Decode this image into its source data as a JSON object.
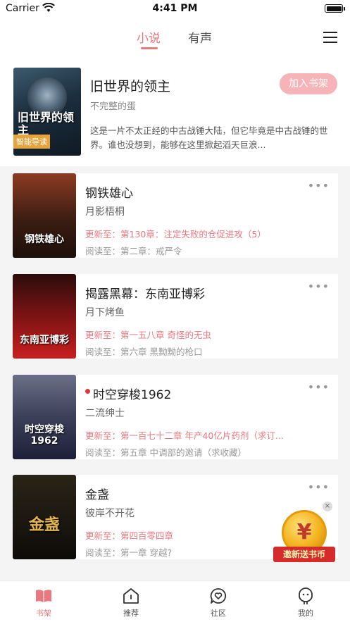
{
  "status": {
    "carrier": "Carrier",
    "time": "4:41 PM"
  },
  "tabs": {
    "novel": "小说",
    "audio": "有声"
  },
  "featured": {
    "title": "旧世界的领主",
    "author": "不完整的蛋",
    "description": "这是一片不太正经的中古战锤大陆，但它毕竟是中古战锤的世界。谁也没想到，能够在这里掀起滔天巨浪...",
    "add_button": "加入书架",
    "cover_title": "旧世界的领主",
    "guide_tag": "智能导读"
  },
  "books": [
    {
      "title": "钢铁雄心",
      "author": "月影梧桐",
      "update": "更新至：第130章：注定失败的仓促进攻（5）",
      "read": "阅读至：第二章：戒严令",
      "cover_text": "钢铁雄心",
      "more": "•••"
    },
    {
      "title": "揭露黑幕：东南亚博彩",
      "author": "月下烤鱼",
      "update": "更新至：第一五八章  奇怪的无虫",
      "read": "阅读至：第六章  黑黝黝的枪口",
      "cover_text": "东南亚博彩",
      "more": "•••"
    },
    {
      "title": "时空穿梭1962",
      "author": "二流绅士",
      "update": "更新至：第一百七十二章 年产40亿片药剂（求订...",
      "read": "阅读至：第五章 中调部的邀请（求收藏）",
      "cover_text": "时空穿梭 1962",
      "more": "•••"
    },
    {
      "title": "金盏",
      "author": "彼岸不开花",
      "update": "更新至：第四百零四章",
      "read": "阅读至：第一章 穿越?",
      "cover_text": "金盏",
      "more": "•••"
    }
  ],
  "promo": {
    "label": "邀新送书币",
    "symbol": "¥",
    "close": "×"
  },
  "tabbar": {
    "shelf": "书架",
    "recommend": "推荐",
    "community": "社区",
    "mine": "我的"
  },
  "colors": {
    "accent": "#e9787f",
    "add_button_bg": "#f6b3b8"
  }
}
